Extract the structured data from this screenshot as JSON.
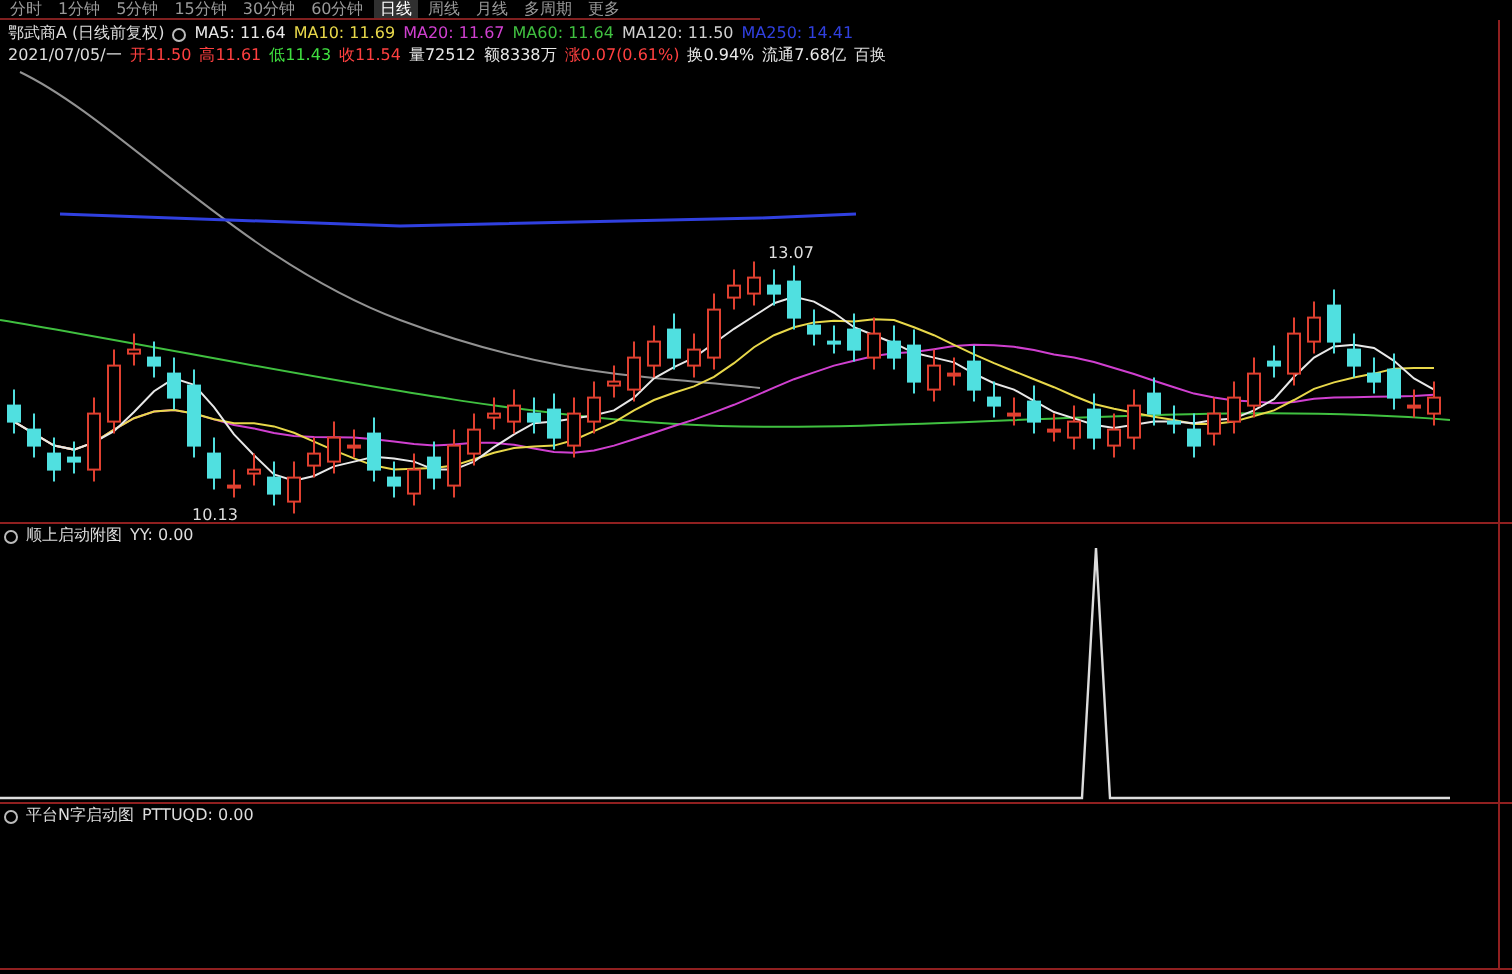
{
  "period_tabs": [
    {
      "label": "分时",
      "selected": false
    },
    {
      "label": "1分钟",
      "selected": false
    },
    {
      "label": "5分钟",
      "selected": false
    },
    {
      "label": "15分钟",
      "selected": false
    },
    {
      "label": "30分钟",
      "selected": false
    },
    {
      "label": "60分钟",
      "selected": false
    },
    {
      "label": "日线",
      "selected": true
    },
    {
      "label": "周线",
      "selected": false
    },
    {
      "label": "月线",
      "selected": false
    },
    {
      "label": "多周期",
      "selected": false
    },
    {
      "label": "更多",
      "selected": false
    }
  ],
  "main_chart": {
    "title": "鄂武商A (日线前复权)",
    "moving_averages": [
      {
        "label": "MA5: 11.64",
        "color": "#e8e8e8"
      },
      {
        "label": "MA10: 11.69",
        "color": "#e8d84a"
      },
      {
        "label": "MA20: 11.67",
        "color": "#d040d0"
      },
      {
        "label": "MA60: 11.64",
        "color": "#40c040"
      },
      {
        "label": "MA120: 11.50",
        "color": "#d0d0d0"
      },
      {
        "label": "MA250: 14.41",
        "color": "#3040e0"
      }
    ],
    "date": "2021/07/05/一",
    "quote": [
      {
        "label": "开",
        "value": "11.50",
        "color": "#ff4040"
      },
      {
        "label": "高",
        "value": "11.61",
        "color": "#ff4040"
      },
      {
        "label": "低",
        "value": "11.43",
        "color": "#40e040"
      },
      {
        "label": "收",
        "value": "11.54",
        "color": "#ff4040"
      },
      {
        "label": "量",
        "value": "72512",
        "color": "#e8e8e8"
      },
      {
        "label": "额",
        "value": "8338万",
        "color": "#e8e8e8"
      },
      {
        "label": "涨",
        "value": "0.07(0.61%)",
        "color": "#ff4040"
      },
      {
        "label": "换",
        "value": "0.94%",
        "color": "#e8e8e8"
      },
      {
        "label": "流通",
        "value": "7.68亿",
        "color": "#e8e8e8"
      }
    ],
    "extra": "百换",
    "high_label": "13.07",
    "low_label": "10.13"
  },
  "indicator_panels": [
    {
      "title": "顺上启动附图",
      "reading": "YY: 0.00",
      "kind": "spike"
    },
    {
      "title": "平台N字启动图",
      "reading": "PTTUQD: 0.00",
      "kind": "empty"
    }
  ]
}
